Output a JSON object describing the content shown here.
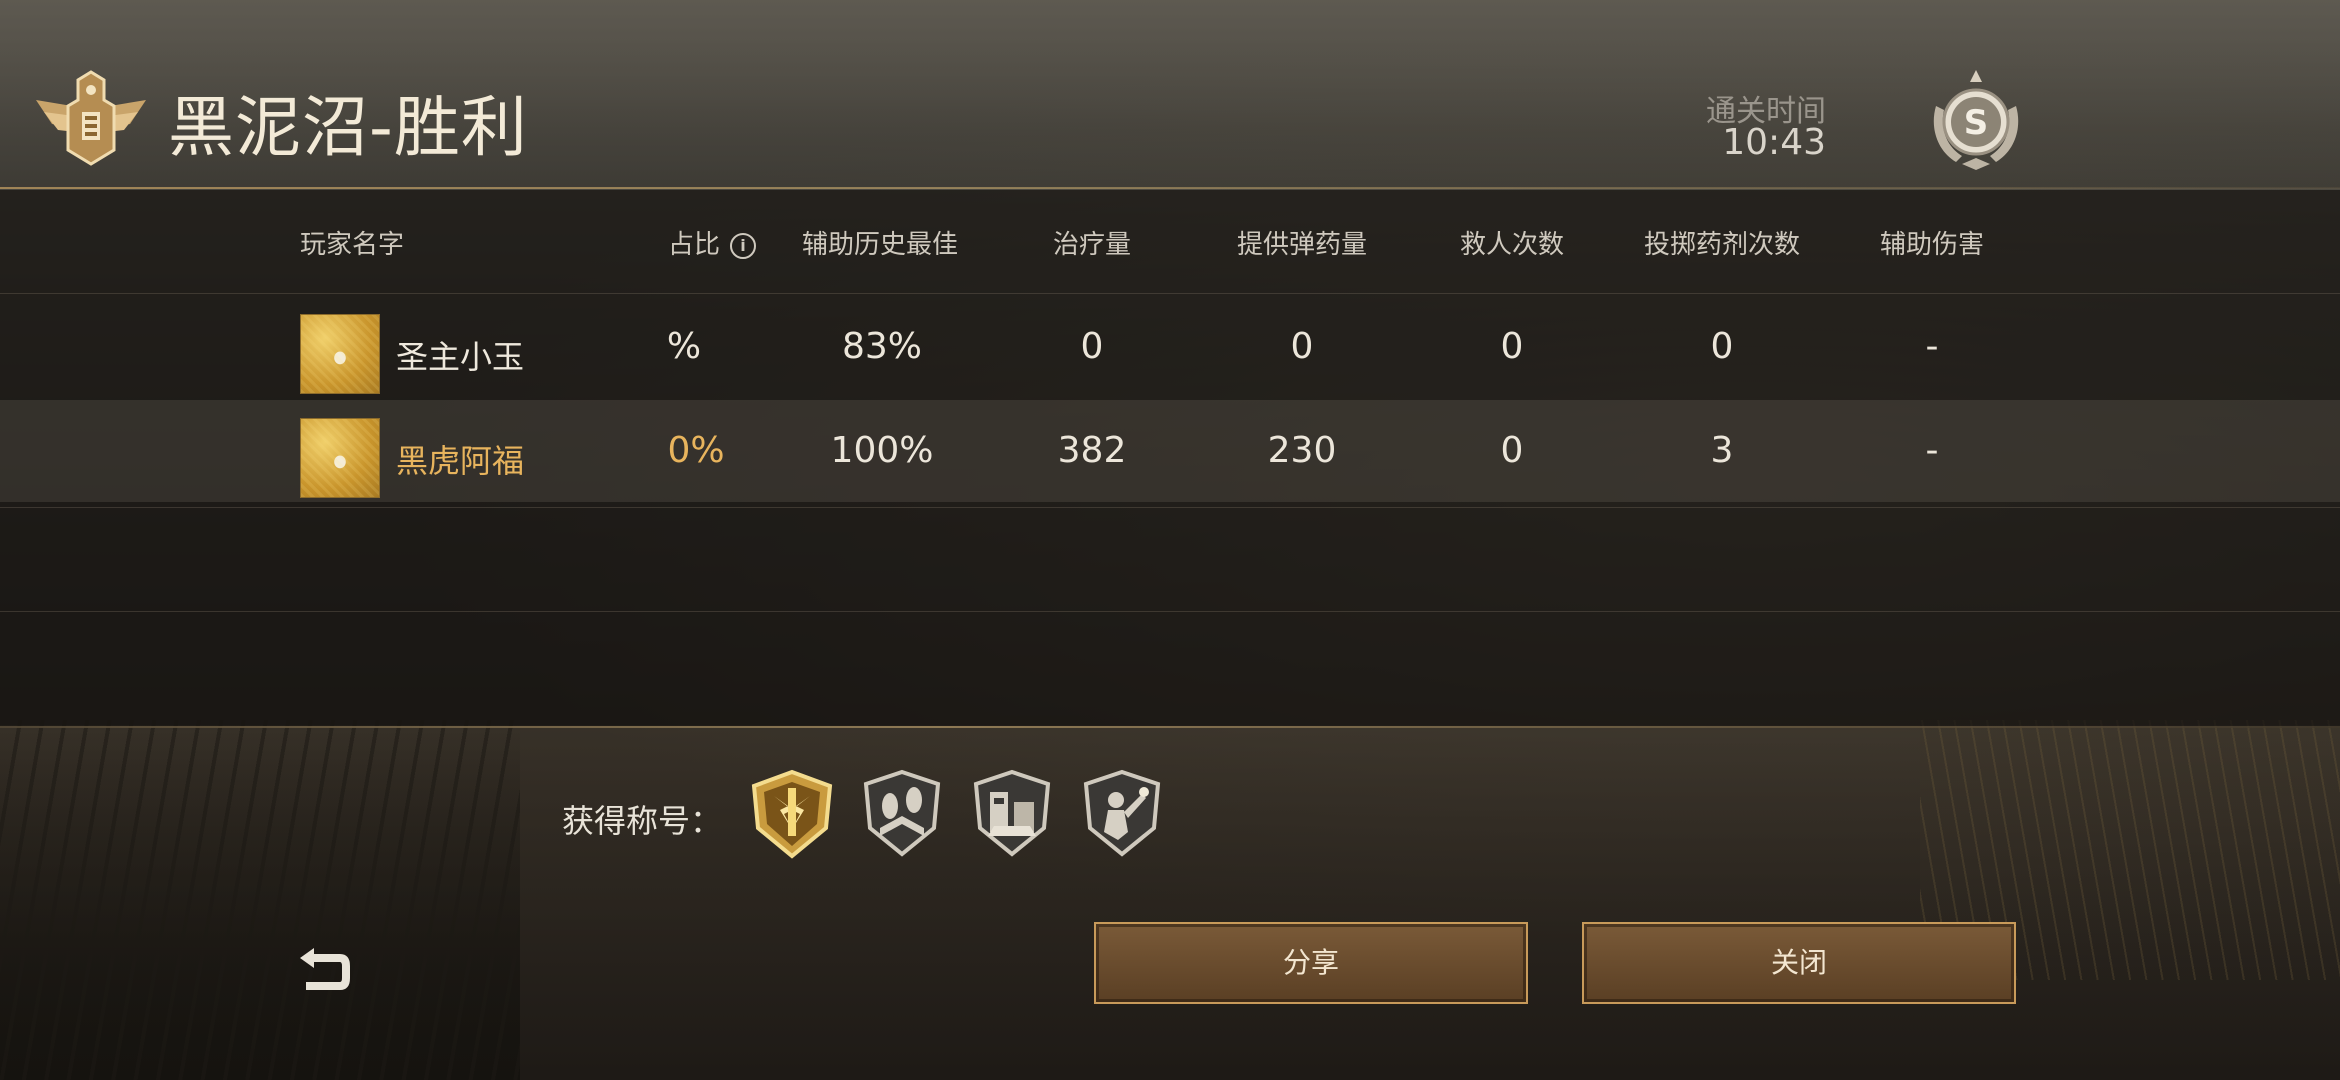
{
  "header": {
    "title": "黑泥沼-胜利",
    "clear_time_label": "通关时间",
    "clear_time": "10:43",
    "rank": "S"
  },
  "table": {
    "columns": [
      "玩家名字",
      "占比",
      "辅助历史最佳",
      "治疗量",
      "提供弹药量",
      "救人次数",
      "投掷药剂次数",
      "辅助伤害"
    ],
    "rows": [
      {
        "name": "圣主小玉",
        "share": "%",
        "best_assist": "83%",
        "healing": "0",
        "ammo": "0",
        "rescues": "0",
        "throws": "0",
        "assist_damage": "-"
      },
      {
        "name": "黑虎阿福",
        "share": "0%",
        "best_assist": "100%",
        "healing": "382",
        "ammo": "230",
        "rescues": "0",
        "throws": "3",
        "assist_damage": "-"
      }
    ]
  },
  "titles": {
    "label": "获得称号：",
    "badges": [
      "golden-lightning-badge-icon",
      "boot-prints-badge-icon",
      "fortress-badge-icon",
      "grenadier-badge-icon"
    ]
  },
  "buttons": {
    "share": "分享",
    "close": "关闭"
  },
  "colors": {
    "accent_gold": "#e8b45d",
    "button_border": "#c89a5a"
  }
}
